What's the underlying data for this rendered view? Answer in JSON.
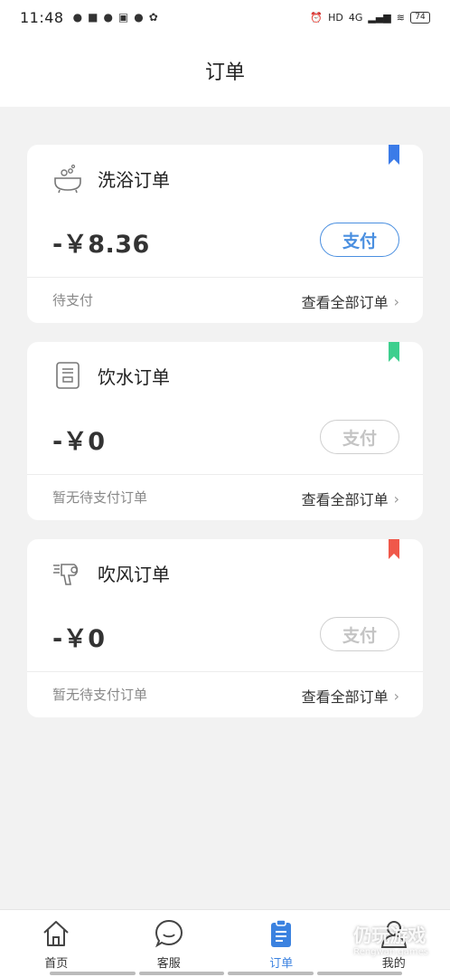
{
  "status_bar": {
    "time": "11:48",
    "battery": "74",
    "network": "4G"
  },
  "header": {
    "title": "订单"
  },
  "orders": [
    {
      "name": "洗浴订单",
      "icon": "bath-icon",
      "amount": "-￥8.36",
      "pay_label": "支付",
      "pay_enabled": true,
      "status": "待支付",
      "view_all": "查看全部订单",
      "bookmark_color": "#3b7be8"
    },
    {
      "name": "饮水订单",
      "icon": "water-dispenser-icon",
      "amount": "-￥0",
      "pay_label": "支付",
      "pay_enabled": false,
      "status": "暂无待支付订单",
      "view_all": "查看全部订单",
      "bookmark_color": "#3ecf8e"
    },
    {
      "name": "吹风订单",
      "icon": "hair-dryer-icon",
      "amount": "-￥0",
      "pay_label": "支付",
      "pay_enabled": false,
      "status": "暂无待支付订单",
      "view_all": "查看全部订单",
      "bookmark_color": "#f0584a"
    }
  ],
  "tabs": [
    {
      "label": "首页",
      "icon": "home-icon",
      "active": false
    },
    {
      "label": "客服",
      "icon": "chat-icon",
      "active": false
    },
    {
      "label": "订单",
      "icon": "clipboard-icon",
      "active": true
    },
    {
      "label": "我的",
      "icon": "user-icon",
      "active": false
    }
  ],
  "watermark": {
    "text": "仍玩游戏",
    "sub": "Rengwan.games"
  },
  "colors": {
    "accent": "#3b82e0",
    "background": "#f2f2f2"
  }
}
